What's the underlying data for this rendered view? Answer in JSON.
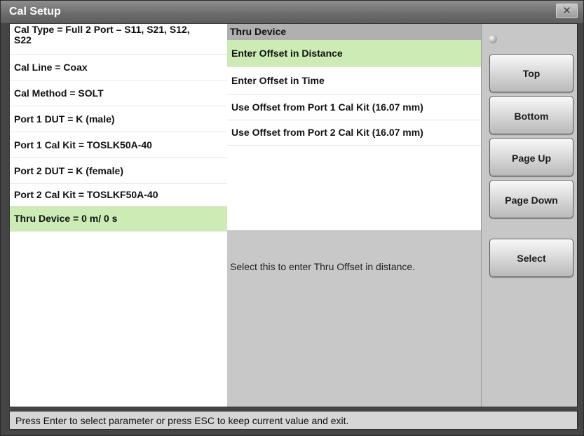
{
  "window": {
    "title": "Cal Setup",
    "close_glyph": "✕"
  },
  "left_list": {
    "items": [
      {
        "line1": "Cal Type = Full 2 Port – S11, S21, S12,",
        "line2": "S22"
      },
      {
        "line1": "Cal Line = Coax"
      },
      {
        "line1": "Cal Method = SOLT"
      },
      {
        "line1": "Port 1 DUT = K (male)"
      },
      {
        "line1": "Port 1 Cal Kit = TOSLK50A-40"
      },
      {
        "line1": "Port 2 DUT = K (female)"
      },
      {
        "line1": "Port 2 Cal Kit = TOSLKF50A-40"
      },
      {
        "line1": "Thru Device = 0 m/ 0 s",
        "selected": true
      }
    ]
  },
  "middle": {
    "header": "Thru Device",
    "options": [
      {
        "label": "Enter Offset in Distance",
        "selected": true
      },
      {
        "label": "Enter Offset in Time"
      },
      {
        "label": "Use Offset from Port 1 Cal Kit (16.07 mm)"
      },
      {
        "label": "Use Offset from Port 2 Cal Kit (16.07 mm)"
      }
    ],
    "description": "Select this to enter Thru Offset in distance."
  },
  "buttons": {
    "top": "Top",
    "bottom": "Bottom",
    "page_up": "Page Up",
    "page_down": "Page Down",
    "select": "Select"
  },
  "status": "Press Enter to select parameter or press ESC to keep current value and exit.",
  "colors": {
    "selected_row": "#ccebb5",
    "header_bg": "#b0b0b0",
    "title_bg": "#6b6b6b"
  }
}
